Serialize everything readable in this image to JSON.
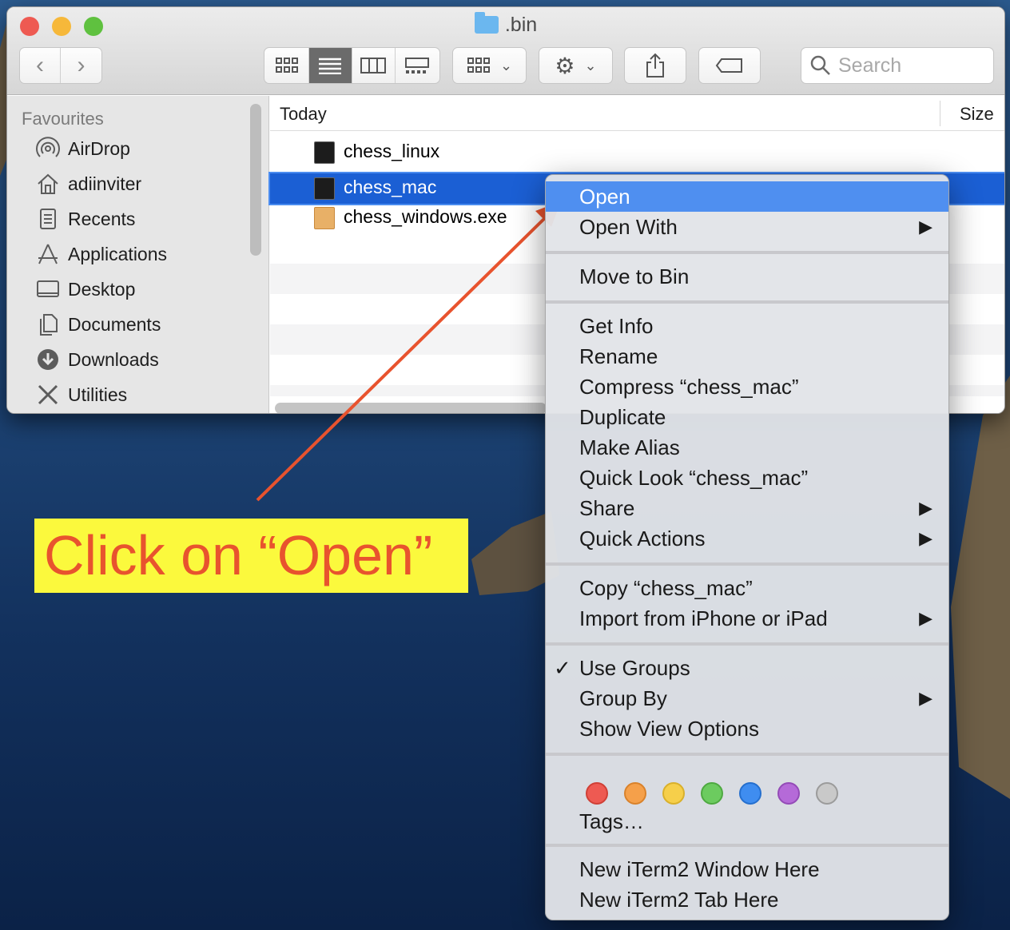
{
  "window": {
    "title": ".bin",
    "search_placeholder": "Search",
    "colors": {
      "close": "#ee5a52",
      "minimize": "#f6b83a",
      "zoom": "#5fc13f",
      "selection": "#1b5fd4"
    }
  },
  "sidebar": {
    "section": "Favourites",
    "items": [
      {
        "label": "AirDrop",
        "icon": "airdrop-icon"
      },
      {
        "label": "adiinviter",
        "icon": "home-icon"
      },
      {
        "label": "Recents",
        "icon": "recents-icon"
      },
      {
        "label": "Applications",
        "icon": "applications-icon"
      },
      {
        "label": "Desktop",
        "icon": "desktop-icon"
      },
      {
        "label": "Documents",
        "icon": "documents-icon"
      },
      {
        "label": "Downloads",
        "icon": "downloads-icon"
      },
      {
        "label": "Utilities",
        "icon": "utilities-icon"
      }
    ]
  },
  "files": {
    "group_header": "Today",
    "size_header": "Size",
    "rows": [
      {
        "name": "chess_linux",
        "icon": "terminal-exec-icon"
      },
      {
        "name": "chess_mac",
        "icon": "terminal-exec-icon",
        "selected": true
      },
      {
        "name": "chess_windows.exe",
        "icon": "exe-file-icon"
      }
    ]
  },
  "context_menu": {
    "open": "Open",
    "open_with": "Open With",
    "move_to_bin": "Move to Bin",
    "get_info": "Get Info",
    "rename": "Rename",
    "compress": "Compress “chess_mac”",
    "duplicate": "Duplicate",
    "make_alias": "Make Alias",
    "quick_look": "Quick Look “chess_mac”",
    "share": "Share",
    "quick_actions": "Quick Actions",
    "copy": "Copy “chess_mac”",
    "import": "Import from iPhone or iPad",
    "use_groups": "Use Groups",
    "group_by": "Group By",
    "show_view_options": "Show View Options",
    "tags": "Tags…",
    "iterm_window": "New iTerm2 Window Here",
    "iterm_tab": "New iTerm2 Tab Here",
    "tag_colors": [
      "#ee5a52",
      "#f5a04a",
      "#f6cf4a",
      "#6ccb5f",
      "#3f8df0",
      "#b56ad8",
      "#b7b7b7"
    ]
  },
  "annotation": {
    "text": "Click on “Open”",
    "background": "#fbf93d",
    "color": "#e8532e"
  }
}
